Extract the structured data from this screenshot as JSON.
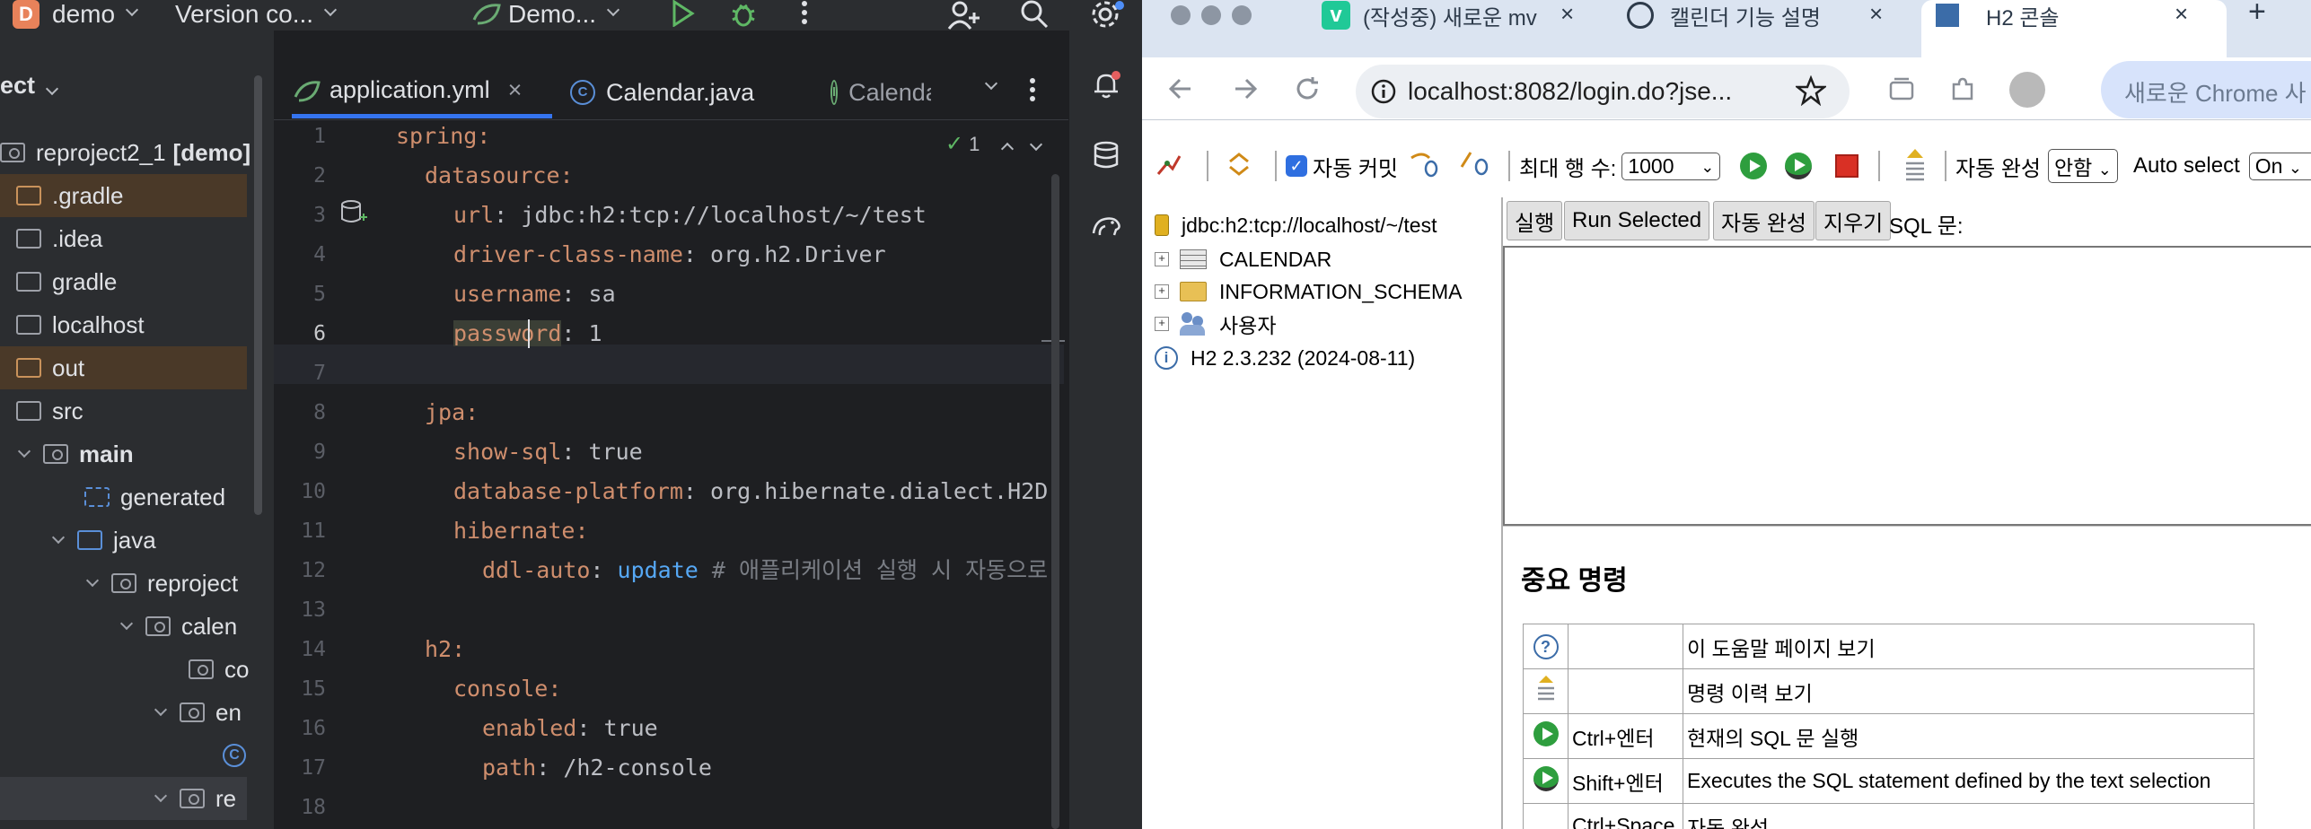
{
  "ide": {
    "project_badge": "D",
    "project_name": "demo",
    "vcs": "Version co...",
    "run_config": "Demo...",
    "panel_title": "ect",
    "tree": [
      {
        "label": "reproject2_1",
        "suffix": "[demo]"
      },
      {
        "label": ".gradle"
      },
      {
        "label": ".idea"
      },
      {
        "label": "gradle"
      },
      {
        "label": "localhost"
      },
      {
        "label": "out"
      },
      {
        "label": "src"
      },
      {
        "label": "main"
      },
      {
        "label": "generated"
      },
      {
        "label": "java"
      },
      {
        "label": "reproject"
      },
      {
        "label": "calen"
      },
      {
        "label": "co"
      },
      {
        "label": "en"
      },
      {
        "label": "re"
      }
    ],
    "tabs": [
      {
        "label": "application.yml",
        "close": "×"
      },
      {
        "label": "Calendar.java"
      },
      {
        "label": "Calenda"
      }
    ],
    "inspection": "1",
    "line_numbers": [
      "1",
      "2",
      "3",
      "4",
      "5",
      "6",
      "7",
      "8",
      "9",
      "10",
      "11",
      "12",
      "13",
      "14",
      "15",
      "16",
      "17",
      "18"
    ],
    "code": {
      "l1": "spring:",
      "l2": "datasource:",
      "l3k": "url",
      "l3v": "jdbc:h2:tcp://localhost/~/test",
      "l4k": "driver-class-name",
      "l4v": "org.h2.Driver",
      "l5k": "username",
      "l5v": "sa",
      "l6k": "password",
      "l6v": "1",
      "l8": "jpa:",
      "l9k": "show-sql",
      "l9v": "true",
      "l10k": "database-platform",
      "l10v": "org.hibernate.dialect.H2D",
      "l11": "hibernate:",
      "l12k": "ddl-auto",
      "l12v": "update",
      "l12c": "# 애플리케이션 실행 시 자동으로 ",
      "l14": "h2:",
      "l15": "console:",
      "l16k": "enabled",
      "l16v": "true",
      "l17k": "path",
      "l17v": "/h2-console"
    }
  },
  "browser": {
    "tabs": [
      {
        "label": "(작성중) 새로운 mv",
        "close": "×"
      },
      {
        "label": "캘린더 기능 설명",
        "close": "×"
      },
      {
        "label": "H2 콘솔",
        "close": "×"
      }
    ],
    "new_tab": "+",
    "url": "localhost:8082/login.do?jse...",
    "search_placeholder": "새로운 Chrome 사",
    "h2": {
      "autocommit_label": "자동 커밋",
      "max_rows_label": "최대 행 수:",
      "max_rows_value": "1000",
      "autocomplete_label": "자동 완성",
      "autocomplete_value": "안함",
      "autoselect_label": "Auto select",
      "autoselect_value": "On",
      "tree_root": "jdbc:h2:tcp://localhost/~/test",
      "tree_items": [
        "CALENDAR",
        "INFORMATION_SCHEMA",
        "사용자"
      ],
      "version": "H2 2.3.232 (2024-08-11)",
      "buttons": [
        "실행",
        "Run Selected",
        "자동 완성",
        "지우기"
      ],
      "sql_label": "SQL 문:",
      "important_title": "중요 명령",
      "help_rows": [
        {
          "key": "",
          "desc": "이 도움말 페이지 보기"
        },
        {
          "key": "",
          "desc": "명령 이력 보기"
        },
        {
          "key": "Ctrl+엔터",
          "desc": "현재의 SQL 문 실행"
        },
        {
          "key": "Shift+엔터",
          "desc": "Executes the SQL statement defined by the text selection"
        },
        {
          "key": "Ctrl+Space",
          "desc": "자동 완성"
        }
      ]
    }
  }
}
